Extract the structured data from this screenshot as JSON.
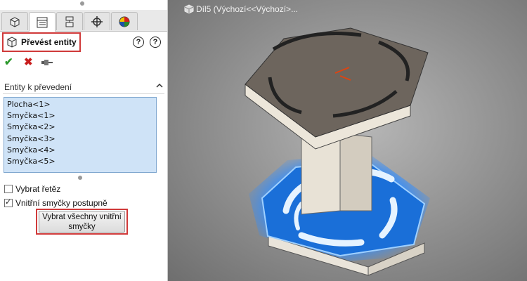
{
  "tabs": [
    {
      "icon": "feature-tree-icon"
    },
    {
      "icon": "property-manager-icon"
    },
    {
      "icon": "configuration-manager-icon"
    },
    {
      "icon": "dimxpert-icon"
    },
    {
      "icon": "display-manager-icon"
    }
  ],
  "property_manager": {
    "title": "Převést entity",
    "actions": {
      "ok": "✔",
      "cancel": "✖",
      "pin": "pin-icon"
    },
    "section_title": "Entity k převedení",
    "entities": [
      "Plocha<1>",
      "Smyčka<1>",
      "Smyčka<2>",
      "Smyčka<3>",
      "Smyčka<4>",
      "Smyčka<5>"
    ],
    "select_chain": {
      "label": "Vybrat řetěz",
      "checked": false
    },
    "inner_loops": {
      "label": "Vnitřní smyčky postupně",
      "checked": true
    },
    "select_all_button": {
      "label": "Vybrat všechny vnitřní smyčky"
    }
  },
  "viewport": {
    "title": "Díl5  (Výchozí<<Výchozí>..."
  },
  "colors": {
    "highlight": "#d03a3a",
    "list_bg": "#cfe3f7",
    "selection_blue": "#1a6fd8"
  }
}
